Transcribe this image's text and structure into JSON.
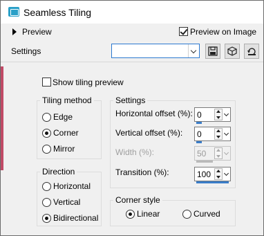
{
  "window": {
    "title": "Seamless Tiling"
  },
  "preview": {
    "label": "Preview",
    "preview_on_image_label": "Preview on Image",
    "preview_on_image_checked": true
  },
  "settings_bar": {
    "label": "Settings",
    "preset_value": "",
    "icons": [
      "save-icon",
      "randomize-icon",
      "reset-icon"
    ]
  },
  "show_tiling_preview": {
    "label": "Show tiling preview",
    "checked": false
  },
  "tiling_method": {
    "title": "Tiling method",
    "options": [
      {
        "label": "Edge",
        "selected": false
      },
      {
        "label": "Corner",
        "selected": true
      },
      {
        "label": "Mirror",
        "selected": false
      }
    ]
  },
  "direction": {
    "title": "Direction",
    "options": [
      {
        "label": "Horizontal",
        "selected": false
      },
      {
        "label": "Vertical",
        "selected": false
      },
      {
        "label": "Bidirectional",
        "selected": true
      }
    ]
  },
  "settings_group": {
    "title": "Settings",
    "fields": [
      {
        "label": "Horizontal offset (%):",
        "value": "0",
        "enabled": true,
        "level_percent": 0
      },
      {
        "label": "Vertical offset (%):",
        "value": "0",
        "enabled": true,
        "level_percent": 0
      },
      {
        "label": "Width (%):",
        "value": "50",
        "enabled": false,
        "level_percent": 50
      },
      {
        "label": "Transition (%):",
        "value": "100",
        "enabled": true,
        "level_percent": 100
      }
    ]
  },
  "corner_style": {
    "title": "Corner style",
    "options": [
      {
        "label": "Linear",
        "selected": true
      },
      {
        "label": "Curved",
        "selected": false
      }
    ]
  },
  "colors": {
    "accent": "#2a78d0",
    "slider_fill": "#3a7dc9",
    "side_accent": "#c04a66"
  }
}
